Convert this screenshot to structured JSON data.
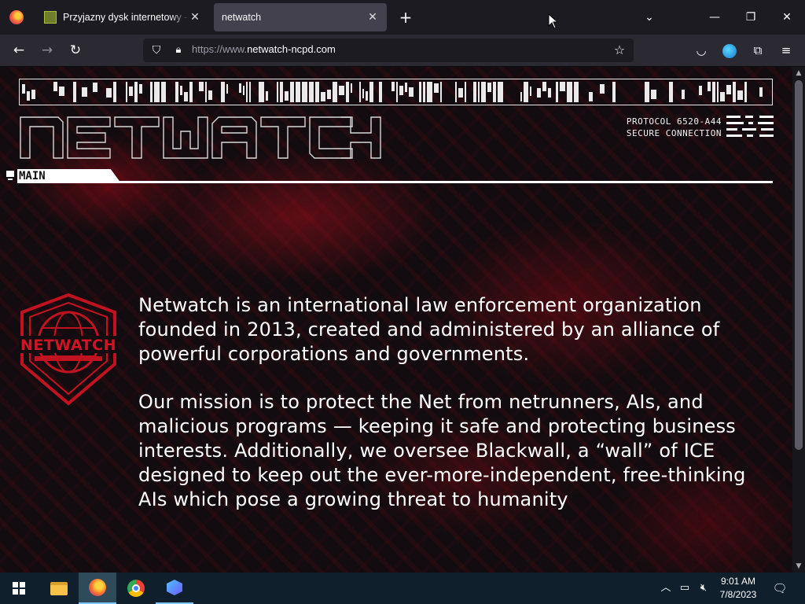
{
  "browser": {
    "tabs": [
      {
        "title": "Przyjazny dysk internetowy - Ch",
        "active": false
      },
      {
        "title": "netwatch",
        "active": true
      }
    ],
    "url_prefix": "https://www.",
    "url_domain": "netwatch-ncpd.com",
    "new_tab_label": "+"
  },
  "page": {
    "logo_text": "NETWATCH",
    "protocol_line1": "PROTOCOL 6520-A44",
    "protocol_line2": "SECURE CONNECTION",
    "section_label": "MAIN",
    "badge_text": "NETWATCH",
    "paragraphs": [
      "Netwatch is an international law enforcement organization founded in 2013, created and administered by an alliance of powerful corporations and governments.",
      "Our mission is to protect the Net from netrunners, AIs, and malicious programs — keeping it safe and protecting business interests. Additionally, we oversee Blackwall, a “wall” of ICE designed to keep out the ever-more-independent, free-thinking AIs which pose a growing threat to humanity"
    ],
    "accent_color": "#c1121f"
  },
  "taskbar": {
    "apps": [
      "file-explorer",
      "firefox",
      "chrome",
      "app"
    ],
    "time": "9:01 AM",
    "date": "7/8/2023"
  }
}
